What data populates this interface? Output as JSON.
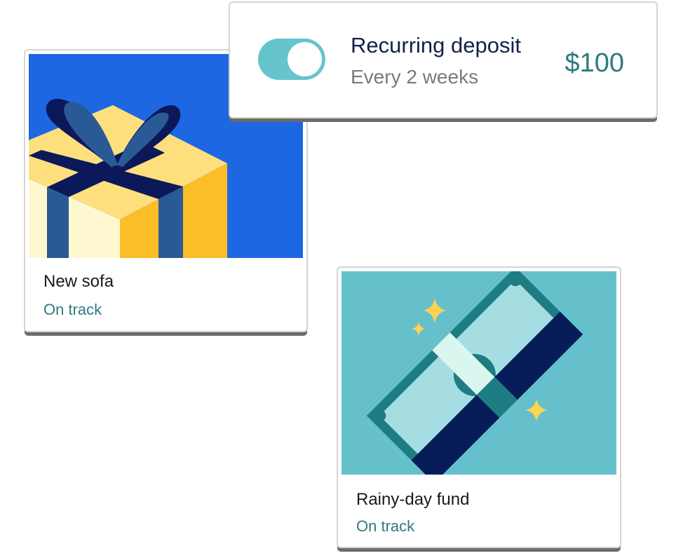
{
  "deposit": {
    "title": "Recurring deposit",
    "frequency": "Every 2 weeks",
    "amount": "$100",
    "toggle_on": true
  },
  "goals": [
    {
      "name": "New sofa",
      "status": "On track",
      "illustration": "gift-box-icon",
      "background_color": "#1e67e3"
    },
    {
      "name": "Rainy-day fund",
      "status": "On track",
      "illustration": "cash-bill-sparkles-icon",
      "background_color": "#65c0cb"
    }
  ],
  "colors": {
    "accent_teal": "#2e7a7f",
    "toggle_teal": "#66c4cd",
    "navy": "#14204a"
  }
}
